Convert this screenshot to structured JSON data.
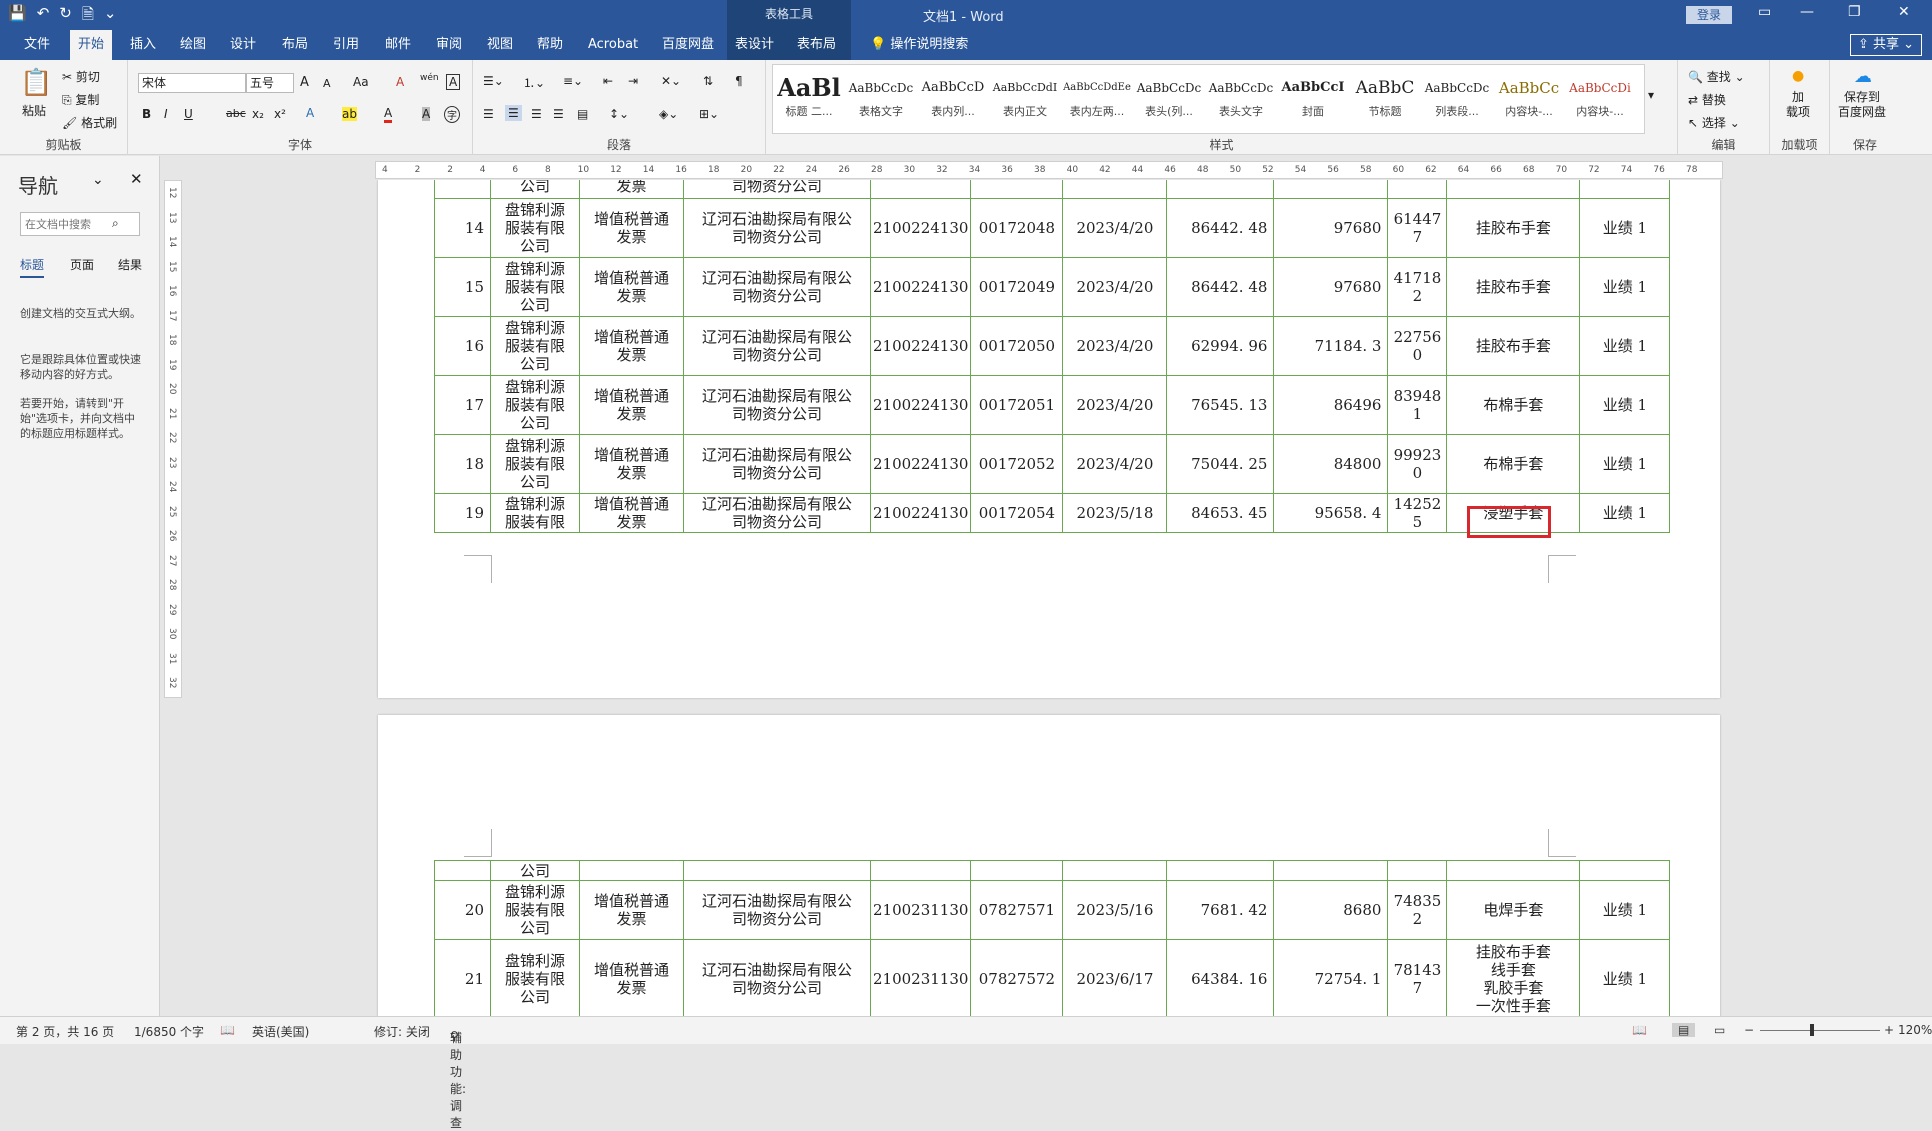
{
  "window": {
    "doc_title": "文档1 - Word",
    "context_group": "表格工具",
    "login": "登录",
    "share": "共享"
  },
  "qat": {
    "save": "💾",
    "undo": "↶",
    "redo": "↻",
    "new": "🗎",
    "more": "⌄"
  },
  "tabs": [
    "文件",
    "开始",
    "插入",
    "绘图",
    "设计",
    "布局",
    "引用",
    "邮件",
    "审阅",
    "视图",
    "帮助",
    "Acrobat",
    "百度网盘",
    "表设计",
    "表布局",
    "操作说明搜索"
  ],
  "ribbon": {
    "clipboard": {
      "label": "剪贴板",
      "paste": "粘贴",
      "cut": "剪切",
      "copy": "复制",
      "format_painter": "格式刷"
    },
    "font": {
      "label": "字体",
      "name": "宋体",
      "size": "五号",
      "bold": "B",
      "italic": "I",
      "underline": "U",
      "strike": "abc",
      "sub": "x₂",
      "sup": "x²",
      "grow": "A",
      "shrink": "A",
      "case": "Aa",
      "pinyin": "wén",
      "border_char": "A",
      "clear": "A",
      "effects": "A",
      "highlight": "ab",
      "color": "A",
      "shade": "A",
      "circle": "字"
    },
    "paragraph": {
      "label": "段落"
    },
    "styles": {
      "label": "样式",
      "items": [
        {
          "preview": "AaBl",
          "name": "标题 二..."
        },
        {
          "preview": "AaBbCcDc",
          "name": "表格文字"
        },
        {
          "preview": "AaBbCcD",
          "name": "表内列..."
        },
        {
          "preview": "AaBbCcDdI",
          "name": "表内正文"
        },
        {
          "preview": "AaBbCcDdEe",
          "name": "表内左两..."
        },
        {
          "preview": "AaBbCcDc",
          "name": "表头(列..."
        },
        {
          "preview": "AaBbCcDc",
          "name": "表头文字"
        },
        {
          "preview": "AaBbCcI",
          "name": "封面"
        },
        {
          "preview": "AaBbC",
          "name": "节标题"
        },
        {
          "preview": "AaBbCcDc",
          "name": "列表段..."
        },
        {
          "preview": "AaBbCc",
          "name": "内容块-..."
        },
        {
          "preview": "AaBbCcDi",
          "name": "内容块-..."
        }
      ]
    },
    "editing": {
      "label": "编辑",
      "find": "查找",
      "replace": "替换",
      "select": "选择"
    },
    "addins": {
      "label": "加载项",
      "name": "加\n载项"
    },
    "save": {
      "label": "保存",
      "name": "保存到\n百度网盘"
    }
  },
  "nav": {
    "title": "导航",
    "search_placeholder": "在文档中搜索",
    "tabs": [
      "标题",
      "页面",
      "结果"
    ],
    "p1": "创建文档的交互式大纲。",
    "p2": "它是跟踪具体位置或快速移动内容的好方式。",
    "p3": "若要开始，请转到\"开始\"选项卡，并向文档中的标题应用标题样式。"
  },
  "ruler_h": [
    "4",
    "2",
    "2",
    "4",
    "6",
    "8",
    "10",
    "12",
    "14",
    "16",
    "18",
    "20",
    "22",
    "24",
    "26",
    "28",
    "30",
    "32",
    "34",
    "36",
    "38",
    "40",
    "42",
    "44",
    "46",
    "48",
    "50",
    "52",
    "54",
    "56",
    "58",
    "60",
    "62",
    "64",
    "66",
    "68",
    "70",
    "72",
    "74",
    "76",
    "78"
  ],
  "ruler_v": [
    "12",
    "13",
    "14",
    "15",
    "16",
    "17",
    "18",
    "19",
    "20",
    "21",
    "22",
    "23",
    "24",
    "25",
    "26",
    "27",
    "28",
    "29",
    "30",
    "31",
    "32"
  ],
  "table_top": {
    "partial": [
      "公司",
      "发票",
      "司物资分公司"
    ],
    "rows": [
      {
        "no": "14",
        "buyer": [
          "盘锦利源",
          "服装有限",
          "公司"
        ],
        "type": [
          "增值税普通",
          "发票"
        ],
        "seller": [
          "辽河石油勘探局有限公",
          "司物资分公司"
        ],
        "code": "2100224130",
        "num": "00172048",
        "date": "2023/4/20",
        "amt": "86442. 48",
        "total": "97680",
        "x": [
          "61447",
          "7"
        ],
        "goods": "挂胶布手套",
        "biz": "业绩 1"
      },
      {
        "no": "15",
        "buyer": [
          "盘锦利源",
          "服装有限",
          "公司"
        ],
        "type": [
          "增值税普通",
          "发票"
        ],
        "seller": [
          "辽河石油勘探局有限公",
          "司物资分公司"
        ],
        "code": "2100224130",
        "num": "00172049",
        "date": "2023/4/20",
        "amt": "86442. 48",
        "total": "97680",
        "x": [
          "41718",
          "2"
        ],
        "goods": "挂胶布手套",
        "biz": "业绩 1"
      },
      {
        "no": "16",
        "buyer": [
          "盘锦利源",
          "服装有限",
          "公司"
        ],
        "type": [
          "增值税普通",
          "发票"
        ],
        "seller": [
          "辽河石油勘探局有限公",
          "司物资分公司"
        ],
        "code": "2100224130",
        "num": "00172050",
        "date": "2023/4/20",
        "amt": "62994. 96",
        "total": "71184. 3",
        "x": [
          "22756",
          "0"
        ],
        "goods": "挂胶布手套",
        "biz": "业绩 1"
      },
      {
        "no": "17",
        "buyer": [
          "盘锦利源",
          "服装有限",
          "公司"
        ],
        "type": [
          "增值税普通",
          "发票"
        ],
        "seller": [
          "辽河石油勘探局有限公",
          "司物资分公司"
        ],
        "code": "2100224130",
        "num": "00172051",
        "date": "2023/4/20",
        "amt": "76545. 13",
        "total": "86496",
        "x": [
          "83948",
          "1"
        ],
        "goods": "布棉手套",
        "biz": "业绩 1"
      },
      {
        "no": "18",
        "buyer": [
          "盘锦利源",
          "服装有限",
          "公司"
        ],
        "type": [
          "增值税普通",
          "发票"
        ],
        "seller": [
          "辽河石油勘探局有限公",
          "司物资分公司"
        ],
        "code": "2100224130",
        "num": "00172052",
        "date": "2023/4/20",
        "amt": "75044. 25",
        "total": "84800",
        "x": [
          "99923",
          "0"
        ],
        "goods": "布棉手套",
        "biz": "业绩 1"
      },
      {
        "no": "19",
        "buyer": [
          "盘锦利源",
          "服装有限"
        ],
        "type": [
          "增值税普通",
          "发票"
        ],
        "seller": [
          "辽河石油勘探局有限公",
          "司物资分公司"
        ],
        "code": "2100224130",
        "num": "00172054",
        "date": "2023/5/18",
        "amt": "84653. 45",
        "total": "95658. 4",
        "x": [
          "14252",
          "5"
        ],
        "goods": "浸塑手套",
        "biz": "业绩 1"
      }
    ]
  },
  "table_bottom": {
    "partial": [
      "公司"
    ],
    "rows": [
      {
        "no": "20",
        "buyer": [
          "盘锦利源",
          "服装有限",
          "公司"
        ],
        "type": [
          "增值税普通",
          "发票"
        ],
        "seller": [
          "辽河石油勘探局有限公",
          "司物资分公司"
        ],
        "code": "2100231130",
        "num": "07827571",
        "date": "2023/5/16",
        "amt": "7681. 42",
        "total": "8680",
        "x": [
          "74835",
          "2"
        ],
        "goods": [
          "电焊手套"
        ],
        "biz": "业绩 1"
      },
      {
        "no": "21",
        "buyer": [
          "盘锦利源",
          "服装有限",
          "公司"
        ],
        "type": [
          "增值税普通",
          "发票"
        ],
        "seller": [
          "辽河石油勘探局有限公",
          "司物资分公司"
        ],
        "code": "2100231130",
        "num": "07827572",
        "date": "2023/6/17",
        "amt": "64384. 16",
        "total": "72754. 1",
        "x": [
          "78143",
          "7"
        ],
        "goods": [
          "挂胶布手套",
          "线手套",
          "乳胶手套",
          "一次性手套"
        ],
        "biz": "业绩 1"
      }
    ]
  },
  "status": {
    "page": "第 2 页，共 16 页",
    "words": "1/6850 个字",
    "lang": "英语(美国)",
    "track": "修订: 关闭",
    "access": "辅助功能: 调查",
    "zoom": "120%"
  }
}
